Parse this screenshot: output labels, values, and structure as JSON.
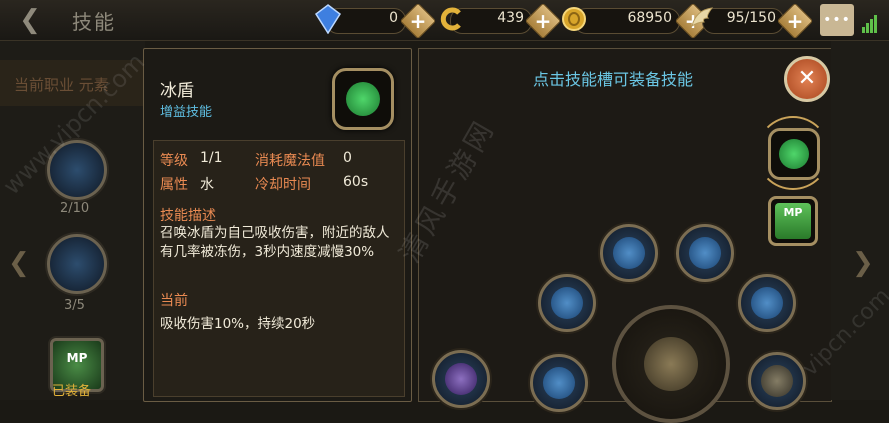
{
  "header": {
    "title": "技能",
    "resources": [
      {
        "name": "diamond",
        "icon": "blue-gem-icon",
        "value": "0"
      },
      {
        "name": "coupon",
        "icon": "gold-c-icon",
        "value": "439"
      },
      {
        "name": "gold",
        "icon": "gold-coin-icon",
        "value": "68950"
      },
      {
        "name": "stamina",
        "icon": "wing-icon",
        "value": "95/150"
      }
    ]
  },
  "left": {
    "tab_label": "当前职业 元素",
    "nodes": [
      {
        "count": "2/10"
      },
      {
        "count": "3/5"
      },
      {
        "label": "已装备",
        "badge": "MP"
      }
    ]
  },
  "detail": {
    "name": "冰盾",
    "type": "增益技能",
    "level_label": "等级",
    "level_value": "1/1",
    "mana_label": "消耗魔法值",
    "mana_value": "0",
    "attr_label": "属性",
    "attr_value": "水",
    "cooldown_label": "冷却时间",
    "cooldown_value": "60s",
    "desc_title": "技能描述",
    "desc_text": "召唤冰盾为自己吸收伤害，附近的敌人有几率被冻伤，3秒内速度减慢30%",
    "current_title": "当前",
    "current_text": "吸收伤害10%，持续20秒"
  },
  "equip": {
    "title": "点击技能槽可装备技能",
    "mp_badge": "MP"
  },
  "watermarks": [
    "清风手游网",
    "www.vipcn.com",
    "vipcn.com"
  ],
  "colors": {
    "accent_blue": "#6bc7e5",
    "label_orange": "#e98a52",
    "gold_frame": "#a58f62"
  }
}
